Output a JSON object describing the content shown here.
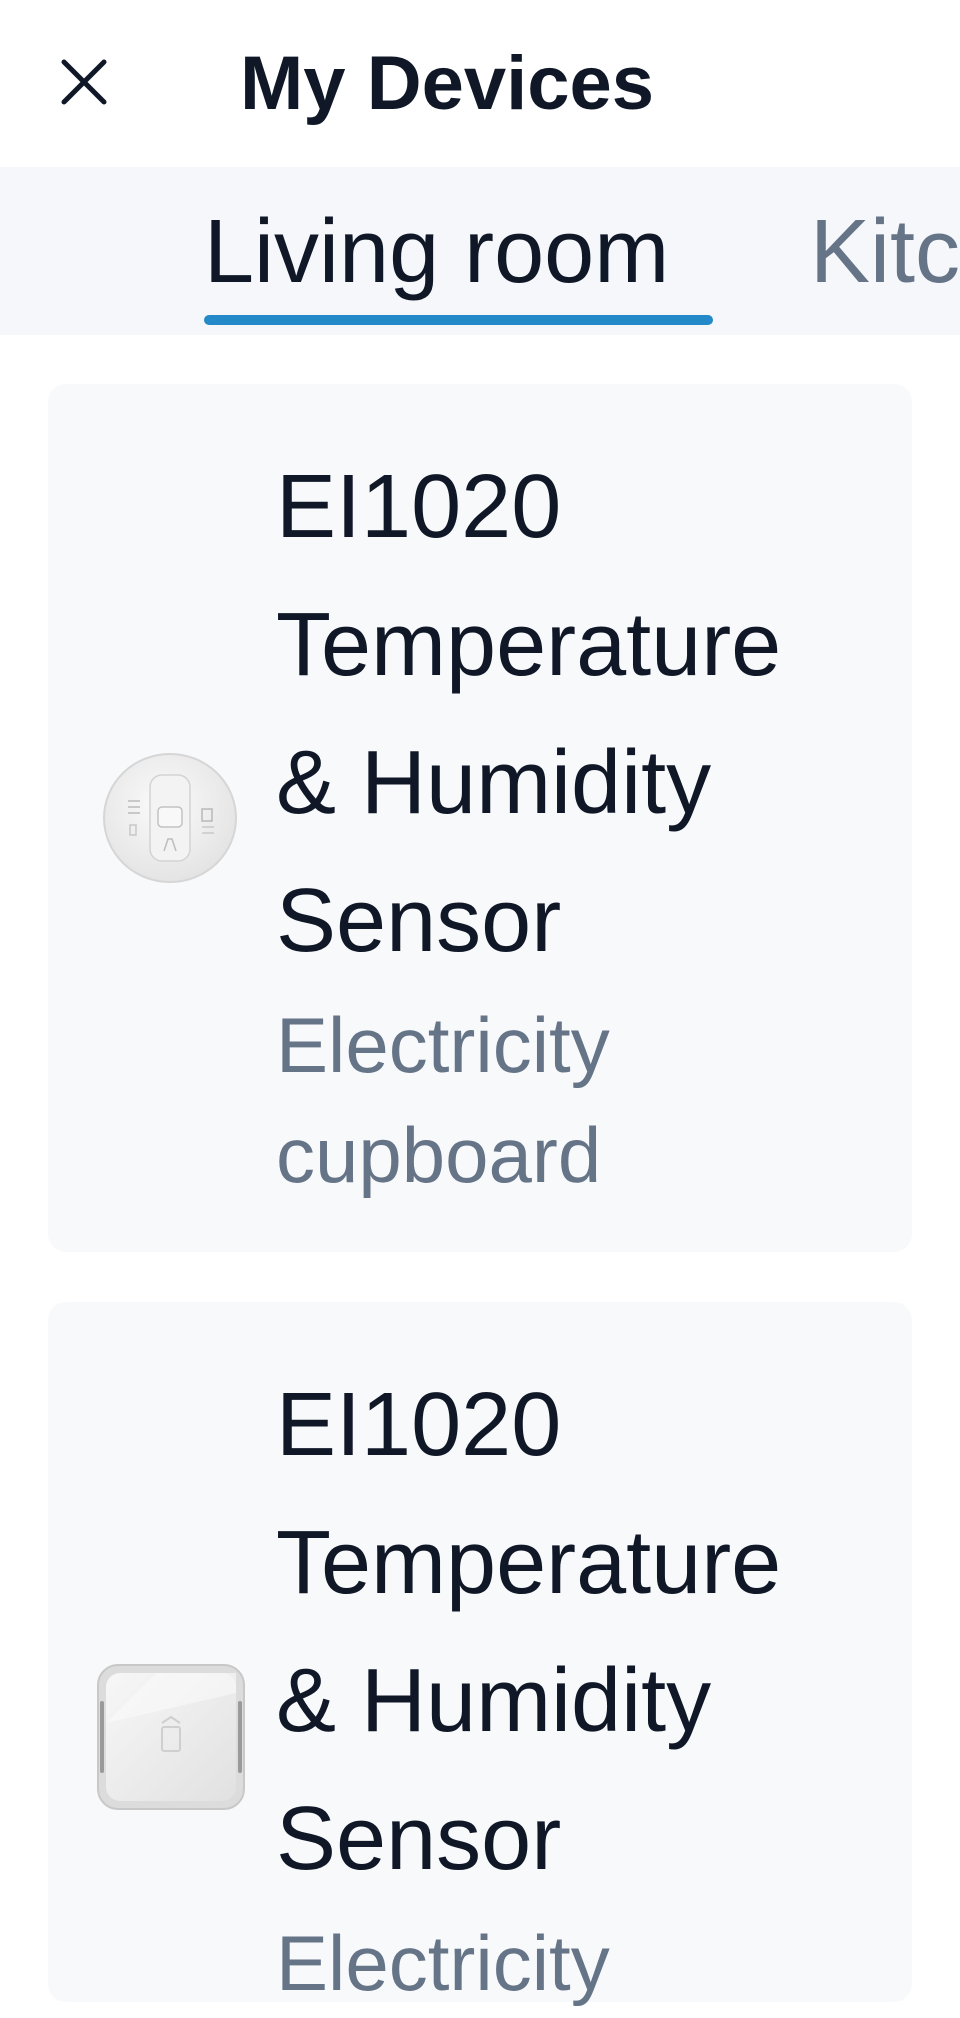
{
  "header": {
    "title": "My Devices",
    "close_icon": "close-icon"
  },
  "tabs": [
    {
      "label": "Living room",
      "active": true
    },
    {
      "label": "Kitc",
      "active": false
    }
  ],
  "devices": [
    {
      "name_lines": [
        "EI1020",
        "Temperature",
        "& Humidity",
        "Sensor"
      ],
      "location_lines": [
        "Electricity",
        "cupboard"
      ],
      "image": "round-smoke-alarm-image"
    },
    {
      "name_lines": [
        "EI1020",
        "Temperature",
        "& Humidity",
        "Sensor"
      ],
      "location_lines": [
        "Electricity"
      ],
      "image": "square-sensor-image"
    }
  ],
  "colors": {
    "accent": "#2389c8",
    "text_primary": "#101828",
    "text_secondary": "#667488",
    "tab_bar_bg": "#f5f7fa",
    "card_bg": "#f8f9fb"
  }
}
